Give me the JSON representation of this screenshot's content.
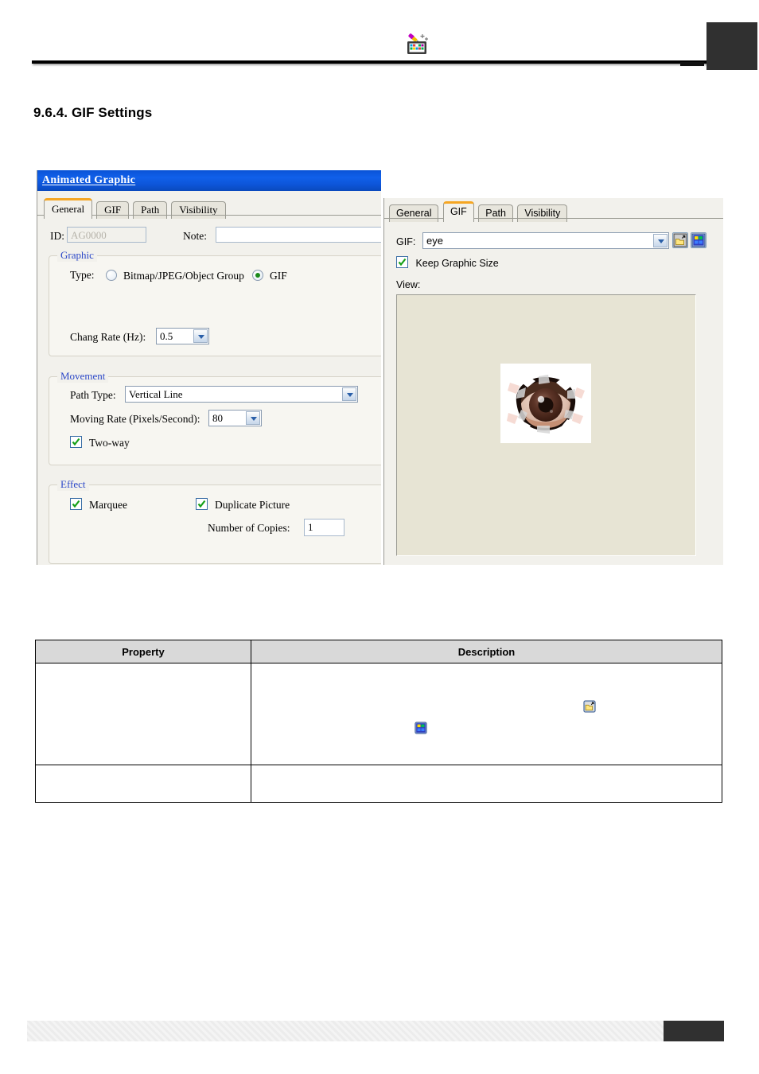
{
  "document": {
    "section_number": "9.6.4.",
    "section_title": "9.6.4. GIF Settings",
    "logo_name": "easybuilder-logo"
  },
  "left_dialog": {
    "title": "Animated Graphic",
    "tabs": [
      {
        "label": "General",
        "active": true
      },
      {
        "label": "GIF",
        "active": false
      },
      {
        "label": "Path",
        "active": false
      },
      {
        "label": "Visibility",
        "active": false
      }
    ],
    "id_label": "ID:",
    "id_value": "AG0000",
    "note_label": "Note:",
    "note_value": "",
    "graphic_group": {
      "title": "Graphic",
      "type_label": "Type:",
      "options": [
        {
          "label": "Bitmap/JPEG/Object Group",
          "selected": false
        },
        {
          "label": "GIF",
          "selected": true
        }
      ],
      "change_rate_label": "Chang Rate (Hz):",
      "change_rate_value": "0.5"
    },
    "movement_group": {
      "title": "Movement",
      "path_type_label": "Path Type:",
      "path_type_value": "Vertical Line",
      "moving_rate_label": "Moving Rate (Pixels/Second):",
      "moving_rate_value": "80",
      "two_way_label": "Two-way",
      "two_way_checked": true
    },
    "effect_group": {
      "title": "Effect",
      "marquee_label": "Marquee",
      "marquee_checked": true,
      "duplicate_label": "Duplicate Picture",
      "duplicate_checked": true,
      "copies_label": "Number of Copies:",
      "copies_value": "1"
    }
  },
  "right_dialog": {
    "tabs": [
      {
        "label": "General",
        "active": false
      },
      {
        "label": "GIF",
        "active": true
      },
      {
        "label": "Path",
        "active": false
      },
      {
        "label": "Visibility",
        "active": false
      }
    ],
    "gif_label": "GIF:",
    "gif_value": "eye",
    "browse_icon": "open-picture-icon",
    "library_icon": "picture-library-icon",
    "keep_graphic_size_label": "Keep Graphic Size",
    "keep_graphic_size_checked": true,
    "view_label": "View:",
    "preview_name": "eye-gif-preview"
  },
  "property_table": {
    "headers": [
      "Property",
      "Description"
    ],
    "rows": [
      {
        "property": "",
        "description": "",
        "icons": [
          "picture-library-icon",
          "open-picture-icon"
        ]
      },
      {
        "property": "",
        "description": "",
        "icons": []
      }
    ]
  },
  "colors": {
    "titlebar_blue": "#0d55d8",
    "tab_accent_orange": "#f5a623",
    "group_title_blue": "#2b47c8",
    "view_background": "#e7e4d4",
    "check_green": "#17a017",
    "table_header_gray": "#d9d9d9"
  }
}
